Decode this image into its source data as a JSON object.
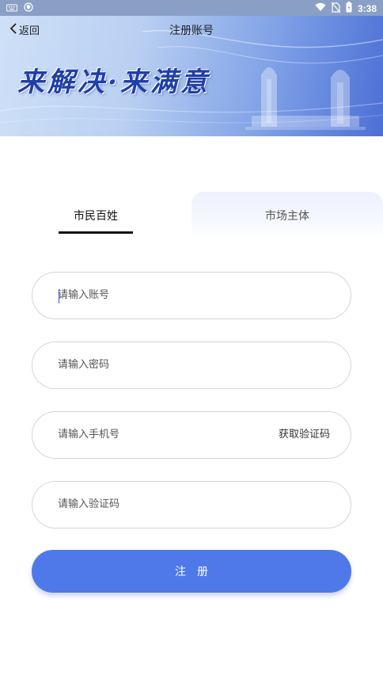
{
  "status_bar": {
    "time": "3:38",
    "icons": [
      "keyboard-icon",
      "shield-icon",
      "wifi-icon",
      "no-sim-icon",
      "battery-icon"
    ]
  },
  "header": {
    "back_label": "返回",
    "title": "注册账号",
    "slogan": "来解决·来满意"
  },
  "tabs": {
    "citizen": "市民百姓",
    "business": "市场主体",
    "active": "citizen"
  },
  "form": {
    "account_placeholder": "请输入账号",
    "password_placeholder": "请输入密码",
    "phone_placeholder": "请输入手机号",
    "get_code_label": "获取验证码",
    "code_placeholder": "请输入验证码",
    "submit_label": "注册"
  },
  "colors": {
    "primary": "#4f79e8",
    "banner_dark": "#4c6fd6",
    "banner_light": "#cfe0f8"
  }
}
